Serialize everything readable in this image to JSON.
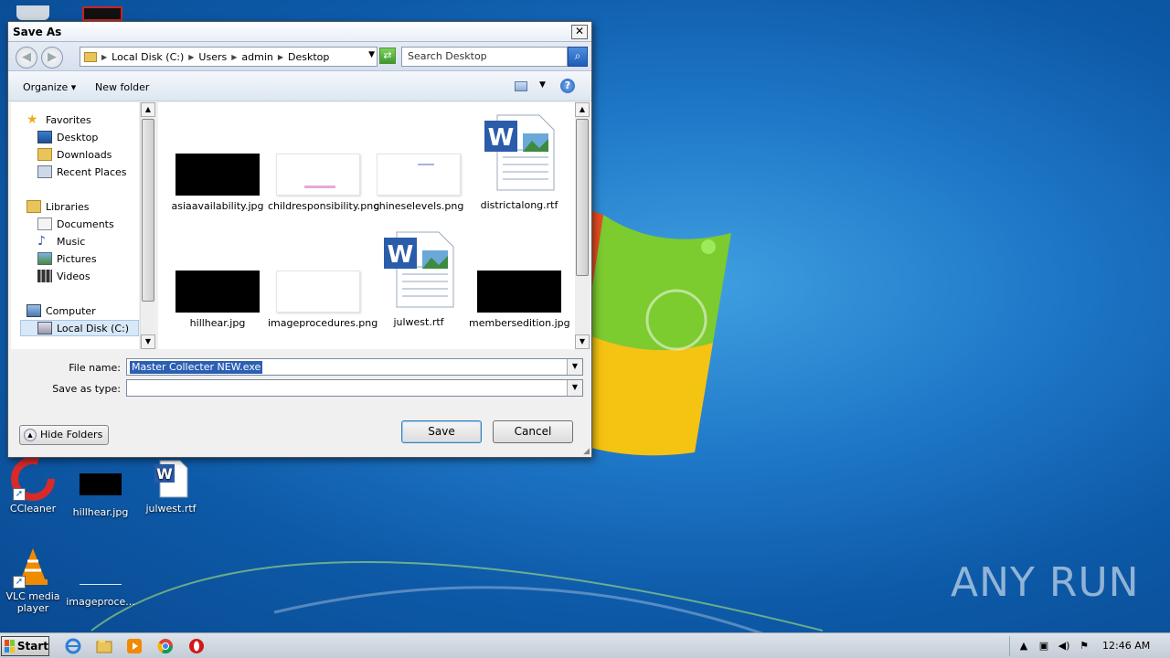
{
  "dialog": {
    "title": "Save As",
    "close_glyph": "✕",
    "breadcrumb": [
      "Local Disk (C:)",
      "Users",
      "admin",
      "Desktop"
    ],
    "search_placeholder": "Search Desktop",
    "toolbar": {
      "organize": "Organize ▾",
      "new_folder": "New folder",
      "help": "?"
    },
    "nav": {
      "favorites": "Favorites",
      "desktop": "Desktop",
      "downloads": "Downloads",
      "recent_places": "Recent Places",
      "libraries": "Libraries",
      "documents": "Documents",
      "music": "Music",
      "pictures": "Pictures",
      "videos": "Videos",
      "computer": "Computer",
      "local_disk": "Local Disk (C:)"
    },
    "files": [
      {
        "name": "asiaavailability.jpg",
        "kind": "black"
      },
      {
        "name": "childresponsibility.png",
        "kind": "white-pink"
      },
      {
        "name": "chineselevels.png",
        "kind": "white"
      },
      {
        "name": "districtalong.rtf",
        "kind": "word"
      },
      {
        "name": "hillhear.jpg",
        "kind": "black"
      },
      {
        "name": "imageprocedures.png",
        "kind": "white"
      },
      {
        "name": "julwest.rtf",
        "kind": "word"
      },
      {
        "name": "membersedition.jpg",
        "kind": "black"
      }
    ],
    "file_name_label": "File name:",
    "file_name_value": "Master Collecter NEW.exe",
    "save_type_label": "Save as type:",
    "save_type_value": "",
    "hide_folders": "Hide Folders",
    "save": "Save",
    "cancel": "Cancel"
  },
  "desktop_icons": {
    "ccleaner": "CCleaner",
    "hillhear": "hillhear.jpg",
    "julwest": "julwest.rtf",
    "vlc": "VLC media player",
    "imageproc": "imageproce..."
  },
  "watermark": "ANY RUN",
  "taskbar": {
    "start": "Start",
    "clock": "12:46 AM"
  },
  "colors": {
    "desktop_blue": "#1f78c8",
    "selection": "#2b5fb3",
    "word_blue": "#2a5caa"
  }
}
